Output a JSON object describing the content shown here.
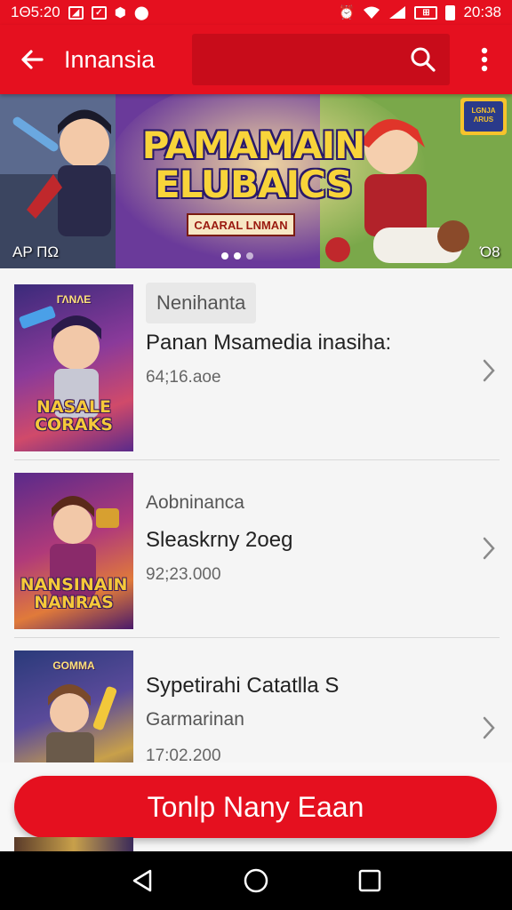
{
  "status_bar": {
    "time_left": "1Θ5:20",
    "time_right": "20:38",
    "icons_left": [
      "notification-icon",
      "image-icon",
      "shield-icon",
      "alert-icon"
    ],
    "icons_right": [
      "alarm-icon",
      "wifi-icon",
      "signal-icon",
      "sim-icon",
      "battery-icon"
    ]
  },
  "app_bar": {
    "title": "Innansia",
    "search_placeholder": "",
    "icons": [
      "back-arrow-icon",
      "search-icon",
      "more-vert-icon"
    ]
  },
  "banner": {
    "title_line1": "PAMAMAIN",
    "title_line2": "ELUBAICS",
    "subtitle": "CAARAL LNMAN",
    "left_tag": "AP ΠΩ",
    "right_tag": "Ό8",
    "corner_badge": "LGNJA ΛRUS",
    "dots": 3,
    "active_dot": 1
  },
  "list": {
    "items": [
      {
        "thumb_top": "ΓΛΝΛΕ",
        "thumb_title": "NASALE CORAKS",
        "tag": "Nenihanta",
        "line1": "Panan Msamedia inasiha:",
        "meta": "64;16.aoe"
      },
      {
        "thumb_top": "",
        "thumb_title": "NANSINAIN NANRAS",
        "line1": "Aobninanca",
        "line2": "Sleaskrny 2oeg",
        "meta": "92;23.000"
      },
      {
        "thumb_top": "GOMMA",
        "thumb_title": "",
        "line1": "Sypetirahi Catatlla S",
        "line2": "Garmarinan",
        "meta": "17:02.200"
      }
    ]
  },
  "cta": {
    "label": "Tonlp Nany Eaan"
  },
  "nav_bar": {
    "icons": [
      "nav-back-icon",
      "nav-home-icon",
      "nav-recents-icon"
    ]
  },
  "colors": {
    "brand": "#e5101f",
    "brand_dark": "#c80c1a",
    "text": "#222222",
    "muted": "#666666"
  }
}
